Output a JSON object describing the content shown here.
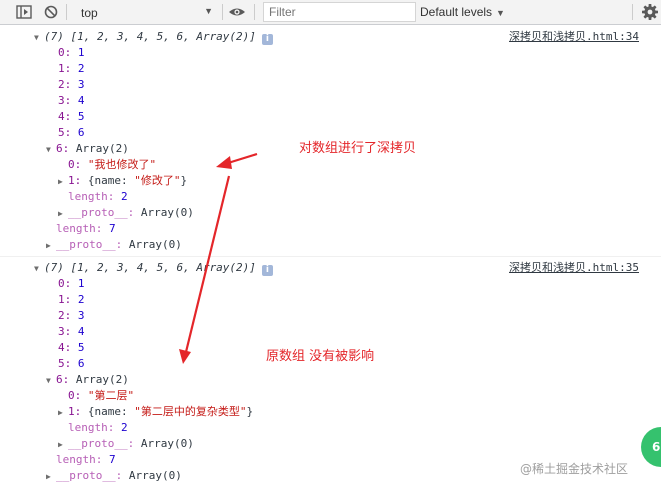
{
  "toolbar": {
    "context_value": "top",
    "filter_placeholder": "Filter",
    "levels_label": "Default levels",
    "levels_arrow": "▼",
    "context_arrow": "▼"
  },
  "entries": [
    {
      "source": "深拷贝和浅拷贝.html:34",
      "summary": "(7) [1, 2, 3, 4, 5, 6, Array(2)]",
      "info": "i",
      "items": [
        {
          "key": "0:",
          "value": "1"
        },
        {
          "key": "1:",
          "value": "2"
        },
        {
          "key": "2:",
          "value": "3"
        },
        {
          "key": "3:",
          "value": "4"
        },
        {
          "key": "4:",
          "value": "5"
        },
        {
          "key": "5:",
          "value": "6"
        }
      ],
      "nested_key": "6:",
      "nested_label": "Array(2)",
      "nested_0_key": "0:",
      "nested_0_value": "\"我也修改了\"",
      "nested_1_key": "1:",
      "nested_1_open": "{name: ",
      "nested_1_value": "\"修改了\"",
      "nested_1_close": "}",
      "nested_length_key": "length:",
      "nested_length_value": "2",
      "nested_proto_key": "__proto__:",
      "nested_proto_value": "Array(0)",
      "length_key": "length:",
      "length_value": "7",
      "proto_key": "__proto__:",
      "proto_value": "Array(0)"
    },
    {
      "source": "深拷贝和浅拷贝.html:35",
      "summary": "(7) [1, 2, 3, 4, 5, 6, Array(2)]",
      "info": "i",
      "items": [
        {
          "key": "0:",
          "value": "1"
        },
        {
          "key": "1:",
          "value": "2"
        },
        {
          "key": "2:",
          "value": "3"
        },
        {
          "key": "3:",
          "value": "4"
        },
        {
          "key": "4:",
          "value": "5"
        },
        {
          "key": "5:",
          "value": "6"
        }
      ],
      "nested_key": "6:",
      "nested_label": "Array(2)",
      "nested_0_key": "0:",
      "nested_0_value": "\"第二层\"",
      "nested_1_key": "1:",
      "nested_1_open": "{name: ",
      "nested_1_value": "\"第二层中的复杂类型\"",
      "nested_1_close": "}",
      "nested_length_key": "length:",
      "nested_length_value": "2",
      "nested_proto_key": "__proto__:",
      "nested_proto_value": "Array(0)",
      "length_key": "length:",
      "length_value": "7",
      "proto_key": "__proto__:",
      "proto_value": "Array(0)"
    }
  ],
  "annotations": {
    "deep_copy": "对数组进行了深拷贝",
    "original": "原数组 没有被影响"
  },
  "watermark": "@稀土掘金技术社区",
  "badge_text": "6",
  "colors": {
    "annotation_red": "#e4262a",
    "key_purple": "#881391",
    "number_blue": "#1c00cf",
    "string_red": "#c41a16"
  }
}
